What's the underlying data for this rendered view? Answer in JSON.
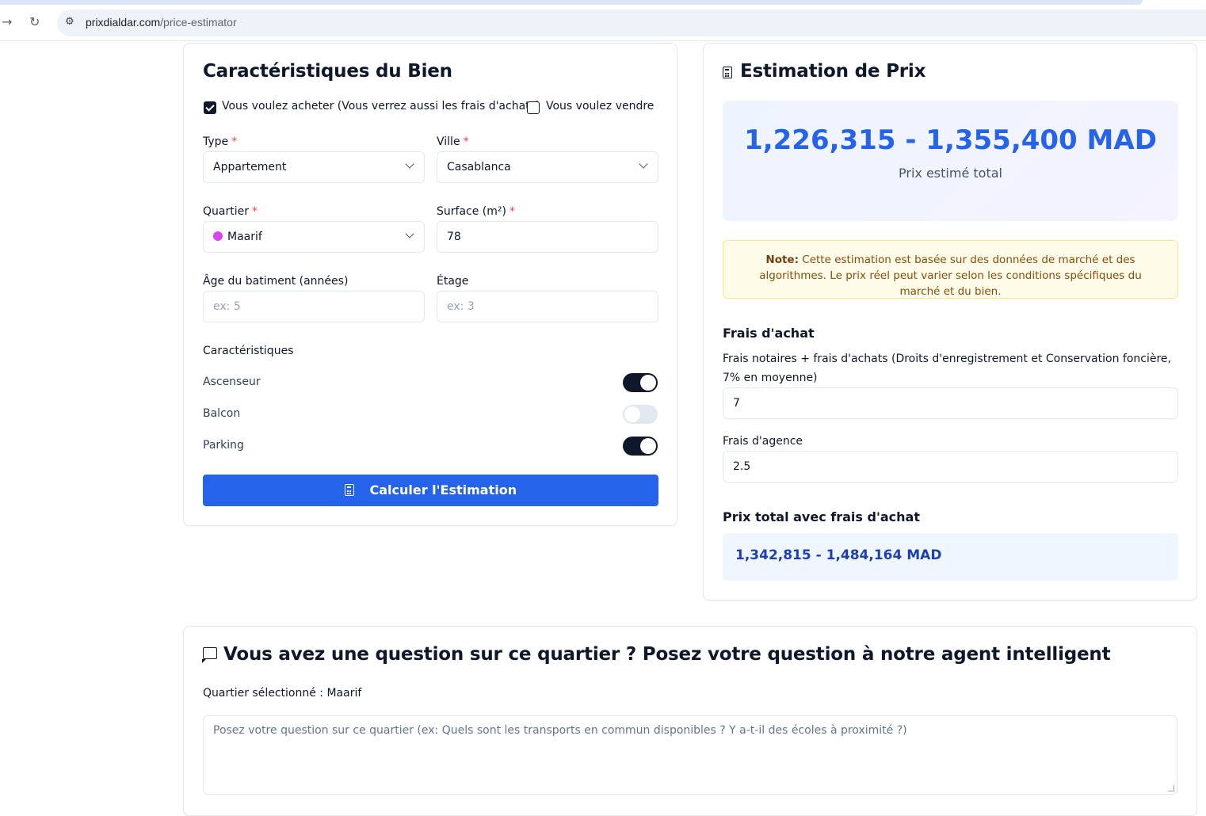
{
  "browser": {
    "url_host": "prixdialdar.com",
    "url_path": "/price-estimator"
  },
  "property_card": {
    "title": "Caractéristiques du Bien",
    "buy_checkbox": {
      "label": "Vous voulez acheter (Vous verrez aussi les frais d'achats)",
      "checked": true
    },
    "sell_checkbox": {
      "label": "Vous voulez vendre",
      "checked": false
    },
    "type": {
      "label": "Type",
      "required_mark": "*",
      "value": "Appartement"
    },
    "city": {
      "label": "Ville",
      "required_mark": "*",
      "value": "Casablanca"
    },
    "district": {
      "label": "Quartier",
      "required_mark": "*",
      "value": "Maarif",
      "dot_color": "#d946ef"
    },
    "surface": {
      "label": "Surface (m²)",
      "required_mark": "*",
      "value": "78"
    },
    "age": {
      "label": "Âge du batiment (années)",
      "placeholder": "ex: 5"
    },
    "floor": {
      "label": "Étage",
      "placeholder": "ex: 3"
    },
    "features_heading": "Caractéristiques",
    "features": [
      {
        "label": "Ascenseur",
        "on": true
      },
      {
        "label": "Balcon",
        "on": false
      },
      {
        "label": "Parking",
        "on": true
      }
    ],
    "submit_label": "Calculer l'Estimation"
  },
  "estimate_card": {
    "title": "Estimation de Prix",
    "range": "1,226,315 - 1,355,400 MAD",
    "range_caption": "Prix estimé total",
    "note_bold": "Note:",
    "note_text": "Cette estimation est basée sur des données de marché et des algorithmes. Le prix réel peut varier selon les conditions spécifiques du marché et du bien.",
    "fees_heading": "Frais d'achat",
    "notary_desc": "Frais notaires + frais d'achats (Droits d'enregistrement et Conservation foncière, 7% en moyenne)",
    "notary_value": "7",
    "agency_label": "Frais d'agence",
    "agency_value": "2.5",
    "total_heading": "Prix total avec frais d'achat",
    "total_range": "1,342,815 - 1,484,164 MAD"
  },
  "chat_card": {
    "title": "Vous avez une question sur ce quartier ? Posez votre question à notre agent intelligent",
    "selected_district": "Quartier sélectionné : Maarif",
    "question_placeholder": "Posez votre question sur ce quartier (ex: Quels sont les transports en commun disponibles ? Y a-t-il des écoles à proximité ?)"
  },
  "colors": {
    "primary": "#2563eb",
    "dark": "#0f172a",
    "required": "#ef4444"
  }
}
